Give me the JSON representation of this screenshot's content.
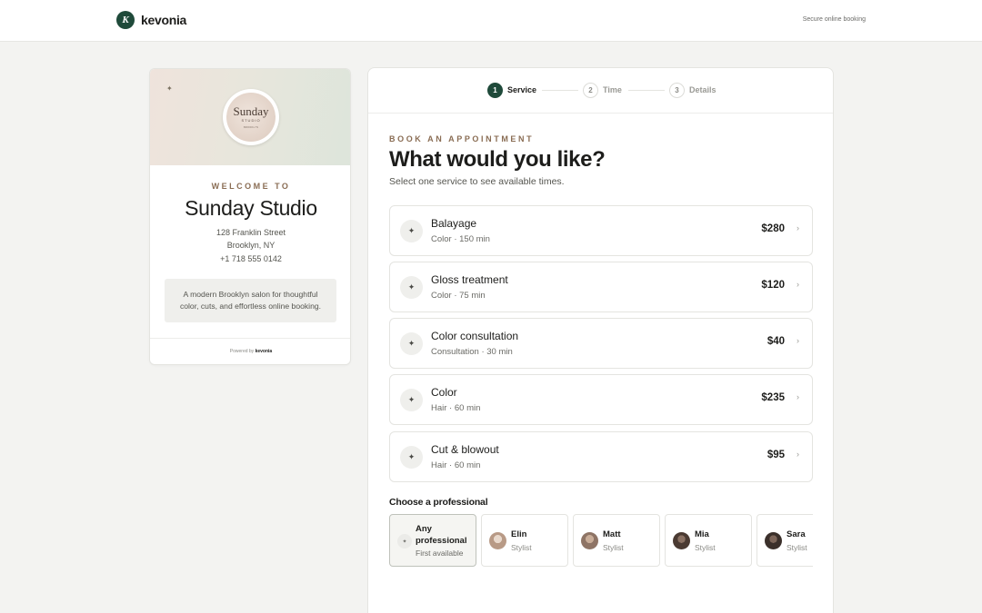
{
  "header": {
    "logo_letter": "K",
    "brand": "kevonia",
    "secure_text": "Secure online booking"
  },
  "salon": {
    "sparkle": "✦",
    "logo_main": "Sunday",
    "logo_sub": "STUDIO",
    "logo_tiny": "BROOKLYN",
    "welcome": "WELCOME TO",
    "name": "Sunday Studio",
    "address_line1": "128 Franklin Street",
    "address_line2": "Brooklyn, NY",
    "phone": "+1 718 555 0142",
    "about_line1": "A modern Brooklyn salon for thoughtful",
    "about_line2": "color, cuts, and effortless online booking.",
    "powered_prefix": "Powered by",
    "powered_brand": "kevonia"
  },
  "steps": [
    {
      "number": "1",
      "label": "Service",
      "state": "active"
    },
    {
      "number": "2",
      "label": "Time",
      "state": "idle"
    },
    {
      "number": "3",
      "label": "Details",
      "state": "idle"
    }
  ],
  "booking": {
    "eyebrow": "BOOK AN APPOINTMENT",
    "title": "What would you like?",
    "subtitle": "Select one service to see available times."
  },
  "services": [
    {
      "icon": "sparkle-icon",
      "glyph": "✦",
      "name": "Balayage",
      "meta": "Color · 150 min",
      "price": "$280",
      "chevron": "›"
    },
    {
      "icon": "sparkle-icon",
      "glyph": "✦",
      "name": "Gloss treatment",
      "meta": "Color · 75 min",
      "price": "$120",
      "chevron": "›"
    },
    {
      "icon": "sparkle-icon",
      "glyph": "✦",
      "name": "Color consultation",
      "meta": "Consultation · 30 min",
      "price": "$40",
      "chevron": "›"
    },
    {
      "icon": "sparkle-icon",
      "glyph": "✦",
      "name": "Color",
      "meta": "Hair · 60 min",
      "price": "$235",
      "chevron": "›"
    },
    {
      "icon": "sparkle-icon",
      "glyph": "✦",
      "name": "Cut & blowout",
      "meta": "Hair · 60 min",
      "price": "$95",
      "chevron": "›"
    }
  ],
  "professionals": {
    "heading": "Choose a professional",
    "any": {
      "glyph": "✦",
      "name": "Any professional",
      "sub": "First available"
    },
    "people": [
      {
        "name": "Elin",
        "role": "Stylist",
        "photo_color": "#b89a86"
      },
      {
        "name": "Matt",
        "role": "Stylist",
        "photo_color": "#8e7465"
      },
      {
        "name": "Mia",
        "role": "Stylist",
        "photo_color": "#4a3a32"
      },
      {
        "name": "Sara",
        "role": "Stylist",
        "photo_color": "#3b302b"
      }
    ]
  },
  "colors": {
    "brand_green": "#1f4a3a",
    "eyebrow_brown": "#8a6d54",
    "page_bg": "#f3f3f1"
  }
}
